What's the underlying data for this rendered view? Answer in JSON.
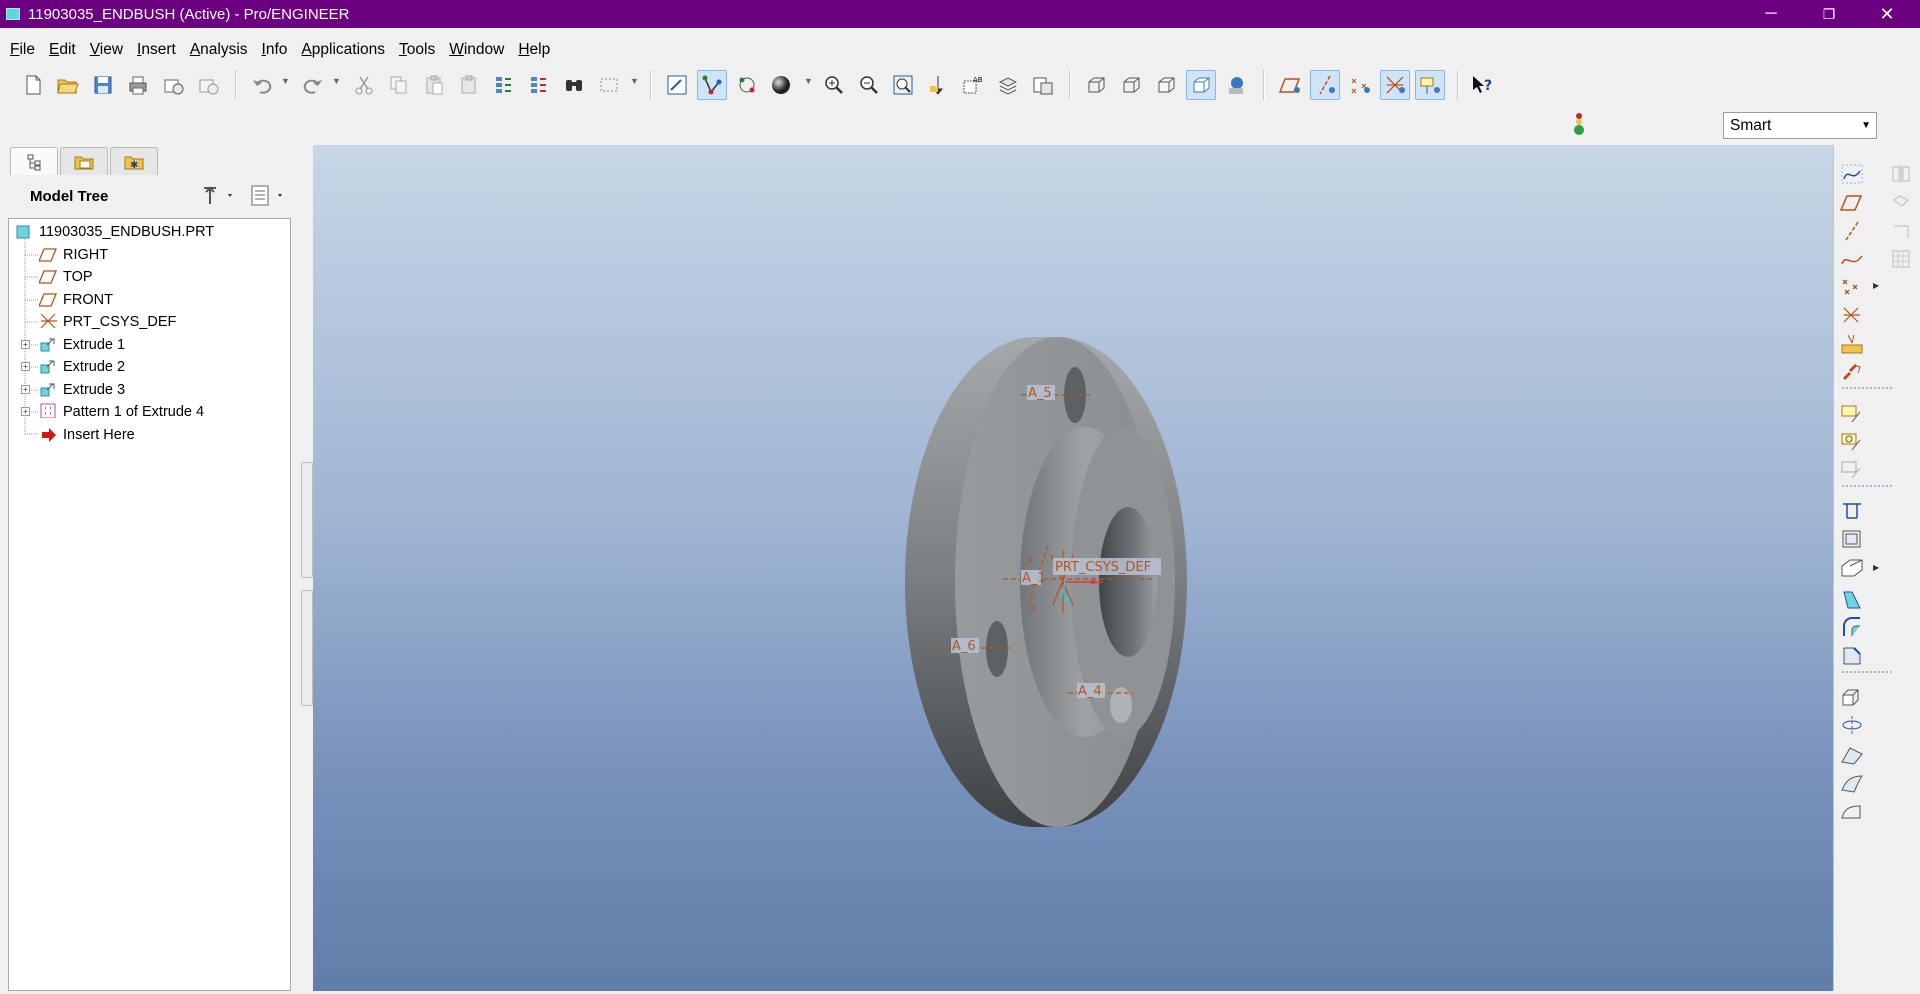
{
  "window": {
    "title": "11903035_ENDBUSH (Active) - Pro/ENGINEER",
    "minimize_glyph": "─",
    "restore_glyph": "❐",
    "close_glyph": "✕"
  },
  "menu": [
    {
      "label": "File",
      "key": "F",
      "rest": "ile"
    },
    {
      "label": "Edit",
      "key": "E",
      "rest": "dit"
    },
    {
      "label": "View",
      "key": "V",
      "rest": "iew"
    },
    {
      "label": "Insert",
      "key": "I",
      "rest": "nsert"
    },
    {
      "label": "Analysis",
      "key": "A",
      "rest": "nalysis"
    },
    {
      "label": "Info",
      "key": "I",
      "rest": "nfo"
    },
    {
      "label": "Applications",
      "key": "A",
      "rest": "pplications"
    },
    {
      "label": "Tools",
      "key": "T",
      "rest": "ools"
    },
    {
      "label": "Window",
      "key": "W",
      "rest": "indow"
    },
    {
      "label": "Help",
      "key": "H",
      "rest": "elp"
    }
  ],
  "filter": {
    "selected": "Smart"
  },
  "model_tree": {
    "title": "Model Tree",
    "items": [
      {
        "label": "11903035_ENDBUSH.PRT",
        "icon": "part-icon",
        "level": 0,
        "expandable": false
      },
      {
        "label": "RIGHT",
        "icon": "datum-plane-icon",
        "level": 1,
        "expandable": false
      },
      {
        "label": "TOP",
        "icon": "datum-plane-icon",
        "level": 1,
        "expandable": false
      },
      {
        "label": "FRONT",
        "icon": "datum-plane-icon",
        "level": 1,
        "expandable": false
      },
      {
        "label": "PRT_CSYS_DEF",
        "icon": "csys-icon",
        "level": 1,
        "expandable": false
      },
      {
        "label": "Extrude 1",
        "icon": "extrude-icon",
        "level": 1,
        "expandable": true
      },
      {
        "label": "Extrude 2",
        "icon": "extrude-icon",
        "level": 1,
        "expandable": true
      },
      {
        "label": "Extrude 3",
        "icon": "extrude-icon",
        "level": 1,
        "expandable": true
      },
      {
        "label": "Pattern 1 of Extrude 4",
        "icon": "pattern-icon",
        "level": 1,
        "expandable": true
      },
      {
        "label": "Insert Here",
        "icon": "insert-arrow-icon",
        "level": 1,
        "expandable": false
      }
    ]
  },
  "viewport_labels": {
    "axis_a5": "A_5",
    "axis_a6": "A_6",
    "axis_a4": "A_4",
    "axis_a1": "A_1",
    "csys": "PRT_CSYS_DEF",
    "csys_x": "X",
    "csys_z": "Z"
  },
  "colors": {
    "titlebar": "#6b0080",
    "viewport_top": "#c8d6e6",
    "viewport_bottom": "#607ea8",
    "datum": "#b8521e",
    "model_gray": "#8e9396"
  }
}
